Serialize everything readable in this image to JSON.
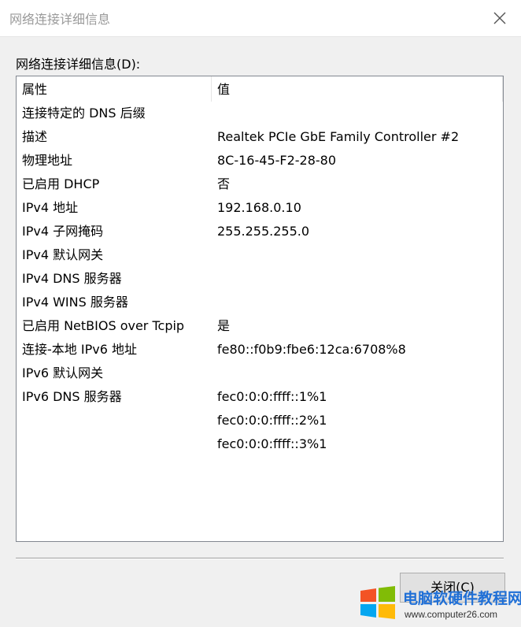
{
  "window": {
    "title": "网络连接详细信息"
  },
  "section_label": "网络连接详细信息(D):",
  "table": {
    "headers": [
      "属性",
      "值"
    ],
    "rows": [
      [
        "连接特定的 DNS 后缀",
        ""
      ],
      [
        "描述",
        "Realtek PCIe GbE Family Controller #2"
      ],
      [
        "物理地址",
        "8C-16-45-F2-28-80"
      ],
      [
        "已启用 DHCP",
        "否"
      ],
      [
        "IPv4 地址",
        "192.168.0.10"
      ],
      [
        "IPv4 子网掩码",
        "255.255.255.0"
      ],
      [
        "IPv4 默认网关",
        ""
      ],
      [
        "IPv4 DNS 服务器",
        ""
      ],
      [
        "IPv4 WINS 服务器",
        ""
      ],
      [
        "已启用 NetBIOS over Tcpip",
        "是"
      ],
      [
        "连接-本地 IPv6 地址",
        "fe80::f0b9:fbe6:12ca:6708%8"
      ],
      [
        "IPv6 默认网关",
        ""
      ],
      [
        "IPv6 DNS 服务器",
        "fec0:0:0:ffff::1%1"
      ],
      [
        "",
        "fec0:0:0:ffff::2%1"
      ],
      [
        "",
        "fec0:0:0:ffff::3%1"
      ]
    ]
  },
  "buttons": {
    "close_label": "关闭(C)"
  },
  "watermark": {
    "text": "电脑软硬件教程网",
    "url": "www.computer26.com"
  },
  "icons": {
    "close": "close-icon",
    "logo": "windows-logo-icon"
  },
  "colors": {
    "watermark_text": "#1f6fd6",
    "titlebar": "#ffffff",
    "dialog_bg": "#f0f0f0"
  }
}
